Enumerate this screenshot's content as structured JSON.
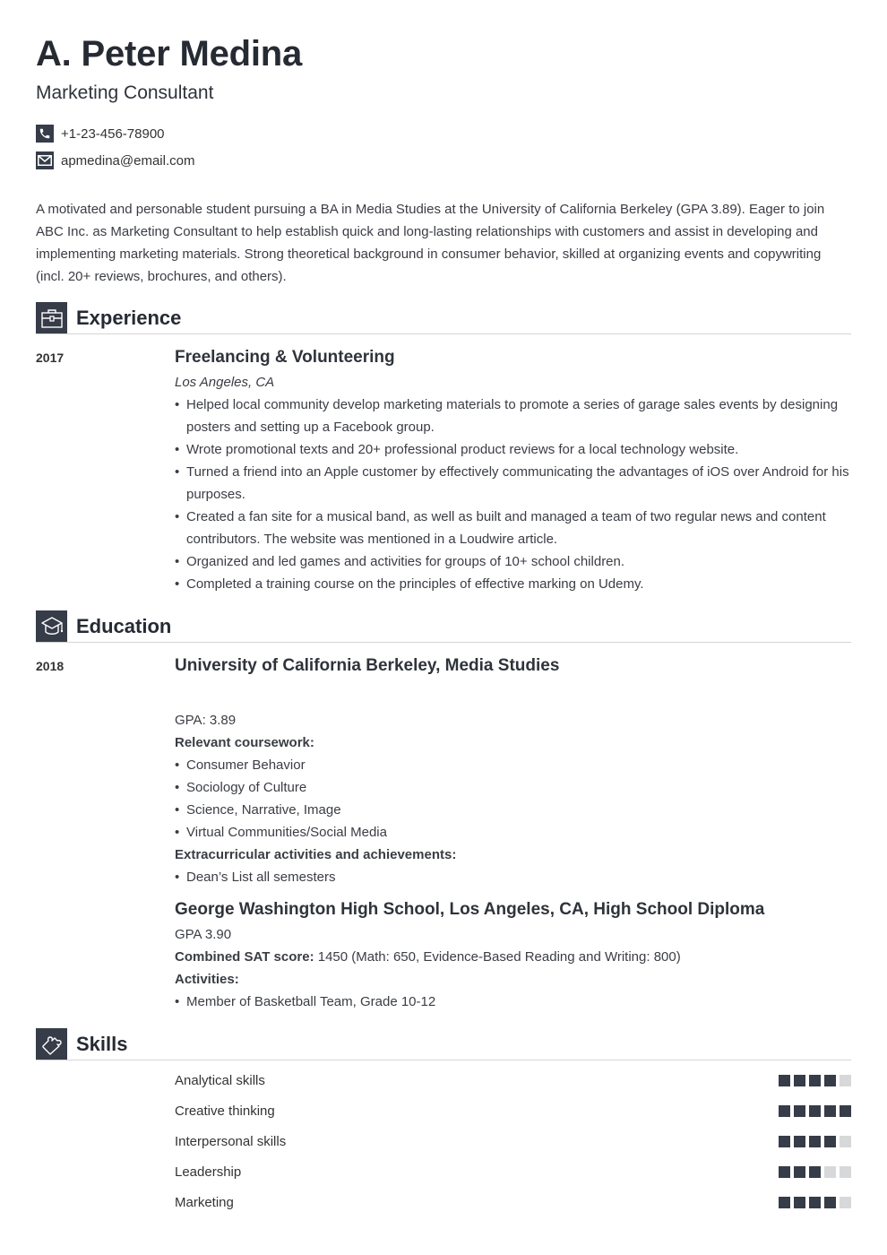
{
  "header": {
    "name": "A. Peter Medina",
    "title": "Marketing Consultant",
    "contacts": [
      {
        "icon": "phone-icon",
        "text": "+1-23-456-78900"
      },
      {
        "icon": "email-icon",
        "text": "apmedina@email.com"
      }
    ]
  },
  "summary": "A motivated and personable student pursuing a BA in Media Studies at the University of California Berkeley (GPA 3.89). Eager to join ABC Inc. as Marketing Consultant to help establish quick and long-lasting relationships with customers and assist in developing and implementing marketing materials. Strong theoretical background in consumer behavior, skilled at organizing events and copywriting (incl. 20+ reviews, brochures, and others).",
  "colors": {
    "accent": "#363c48",
    "rating_off": "#d7d8d9",
    "divider": "#d4d4d4"
  },
  "experience": {
    "heading": "Experience",
    "icon": "briefcase-icon",
    "entries": [
      {
        "year": "2017",
        "title": "Freelancing & Volunteering",
        "location": "Los Angeles, CA",
        "bullets": [
          "Helped local community develop marketing materials to promote a series of garage sales events by designing posters and setting up a Facebook group.",
          "Wrote promotional texts and 20+ professional product reviews for a local technology website.",
          "Turned a friend into an Apple customer by effectively communicating the advantages of iOS over Android for his purposes.",
          "Created a fan site for a musical band, as well as built and managed a team of two regular news and content contributors. The website was mentioned in a Loudwire article.",
          "Organized and led games and activities for groups of 10+ school children.",
          "Completed a training course on the principles of effective marking on Udemy."
        ]
      }
    ]
  },
  "education": {
    "heading": "Education",
    "icon": "graduation-cap-icon",
    "entries": [
      {
        "year": "2018",
        "title": "University of California Berkeley, Media Studies",
        "gpa": "GPA: 3.89",
        "coursework_label": "Relevant coursework:",
        "coursework": [
          "Consumer Behavior",
          "Sociology of Culture",
          "Science, Narrative, Image",
          "Virtual Communities/Social Media"
        ],
        "extra_label": "Extracurricular activities and achievements:",
        "extra": [
          "Dean’s List all semesters"
        ]
      },
      {
        "title": "George Washington High School, Los Angeles, CA, High School Diploma",
        "gpa": "GPA 3.90",
        "sat_label": "Combined SAT score:",
        "sat_value": " 1450 (Math: 650, Evidence-Based Reading and Writing: 800)",
        "activities_label": "Activities:",
        "activities": [
          "Member of Basketball Team, Grade 10-12"
        ]
      }
    ]
  },
  "skills": {
    "heading": "Skills",
    "icon": "puzzle-piece-icon",
    "max_rating": 5,
    "items": [
      {
        "name": "Analytical skills",
        "rating": 4
      },
      {
        "name": "Creative thinking",
        "rating": 5
      },
      {
        "name": "Interpersonal skills",
        "rating": 4
      },
      {
        "name": "Leadership",
        "rating": 3
      },
      {
        "name": "Marketing",
        "rating": 4
      }
    ]
  }
}
